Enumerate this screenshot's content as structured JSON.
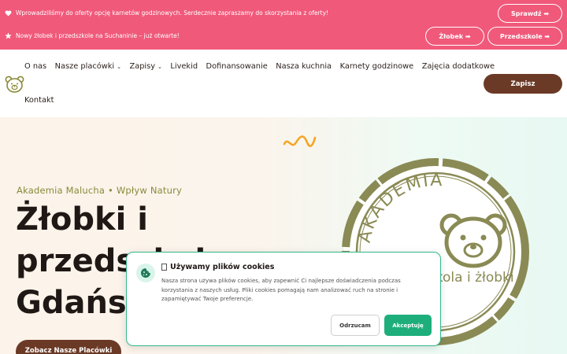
{
  "announcements": [
    {
      "icon": "heart-icon",
      "text": "Wprowadziliśmy do oferty opcję karnetów godzinowych. Serdecznie zapraszamy do skorzystania z oferty!"
    },
    {
      "icon": "star-icon",
      "text": "Nowy żłobek i przedszkole na Suchaninie – już otwarte!"
    }
  ],
  "topbar_buttons": {
    "sprawdz": "Sprawdź ➡",
    "zlobek": "Żłobek ➡",
    "przedszkole": "Przedszkole ➡"
  },
  "nav": {
    "items": [
      {
        "label": "O nas",
        "dropdown": false
      },
      {
        "label": "Nasze placówki",
        "dropdown": true
      },
      {
        "label": "Zapisy",
        "dropdown": true
      },
      {
        "label": "Livekid",
        "dropdown": false
      },
      {
        "label": "Dofinansowanie",
        "dropdown": false
      },
      {
        "label": "Nasza kuchnia",
        "dropdown": false
      },
      {
        "label": "Karnety godzinowe",
        "dropdown": false
      },
      {
        "label": "Zajęcia dodatkowe",
        "dropdown": false
      }
    ],
    "kontakt": "Kontakt",
    "zapisz": "Zapisz"
  },
  "hero": {
    "tagline": "Akademia Malucha • Wpływ Natury",
    "headline_lines": [
      "Żłobki i",
      "przedszkola",
      "Gdańsk"
    ],
    "cta": "Zobacz Nasze Placówki",
    "badge_text_top": "AKADEMIA",
    "badge_text_bottom": "szkola i żłobki"
  },
  "cookie": {
    "title": "Używamy plików cookies",
    "text": "Nasza strona używa plików cookies, aby zapewnić Ci najlepsze doświadczenia podczas korzystania z naszych usług. Pliki cookies pomagają nam analizować ruch na stronie i zapamiętywać Twoje preferencje.",
    "reject": "Odrzucam",
    "accept": "Akceptuję"
  },
  "colors": {
    "topbar": "#f0597a",
    "brown": "#6b3a26",
    "olive": "#8a8a3a",
    "green": "#1dae7c"
  }
}
